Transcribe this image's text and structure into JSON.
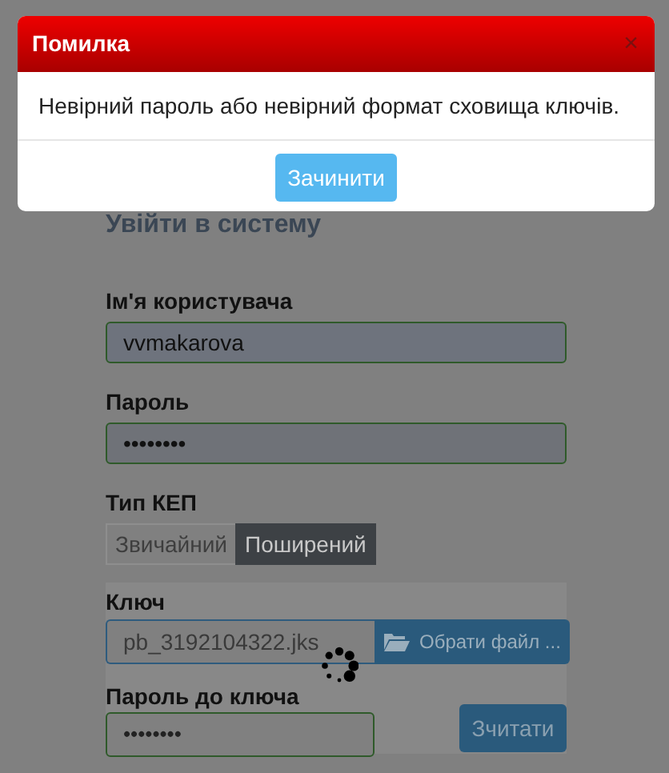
{
  "modal": {
    "title": "Помилка",
    "close": "×",
    "message": "Невірний пароль або невірний формат сховища ключів.",
    "button": "Зачинити"
  },
  "form": {
    "title": "Увійти в систему",
    "username": {
      "label": "Ім'я користувача",
      "value": "vvmakarova"
    },
    "password": {
      "label": "Пароль",
      "value": "••••••••"
    },
    "key_type": {
      "label": "Тип КЕП",
      "options": [
        {
          "label": "Звичайний",
          "selected": false
        },
        {
          "label": "Поширений",
          "selected": true
        }
      ]
    },
    "key": {
      "label": "Ключ",
      "file": "pb_3192104322.jks",
      "browse_button": "Обрати файл ..."
    },
    "key_password": {
      "label": "Пароль до ключа",
      "value": "••••••••"
    },
    "read_button": "Зчитати",
    "loading": true
  }
}
